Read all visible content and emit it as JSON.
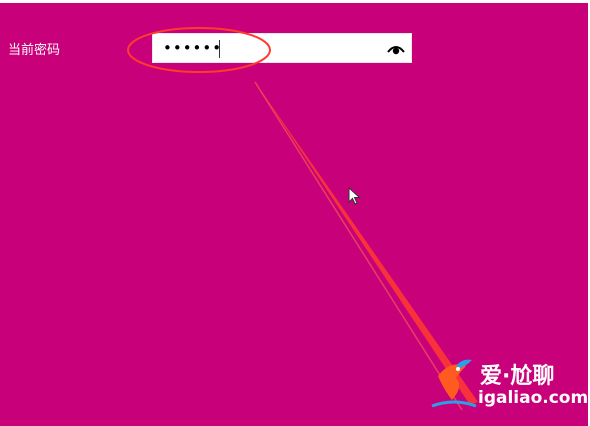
{
  "form": {
    "current_password_label": "当前密码",
    "password_value": "••••••"
  },
  "icons": {
    "reveal": "eye-icon",
    "cursor": "mouse-pointer-icon"
  },
  "annotation": {
    "color": "#ff3b30"
  },
  "watermark": {
    "title": "爱·尬聊",
    "url": "igaliao.com"
  },
  "colors": {
    "background": "#c8007a",
    "field_background": "#ffffff"
  }
}
